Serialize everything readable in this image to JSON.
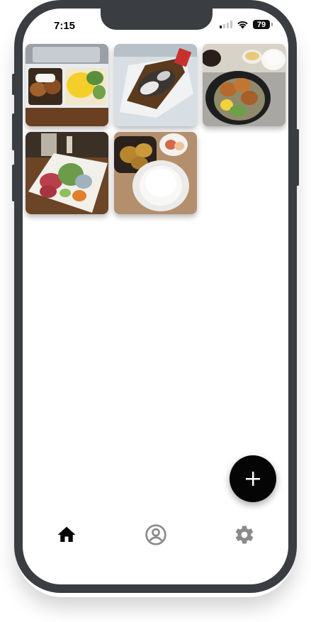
{
  "status_bar": {
    "time": "7:15",
    "battery_level": "79",
    "signal_icon": "cellular-signal-icon",
    "wifi_icon": "wifi-icon"
  },
  "gallery": {
    "photos": [
      {
        "name": "bento-box-photo",
        "description_icon": "photo"
      },
      {
        "name": "grilled-dish-photo",
        "description_icon": "photo"
      },
      {
        "name": "fried-chicken-set-photo",
        "description_icon": "photo"
      },
      {
        "name": "sashimi-platter-photo",
        "description_icon": "photo"
      },
      {
        "name": "curry-rice-photo",
        "description_icon": "photo"
      }
    ]
  },
  "fab": {
    "icon": "plus-icon"
  },
  "bottom_nav": {
    "items": [
      {
        "icon": "home-icon",
        "active": true
      },
      {
        "icon": "profile-icon",
        "active": false
      },
      {
        "icon": "settings-gear-icon",
        "active": false
      }
    ]
  },
  "colors": {
    "active": "#000000",
    "inactive": "#8a8a8a",
    "fab": "#050505",
    "frame": "#3a3d42"
  }
}
